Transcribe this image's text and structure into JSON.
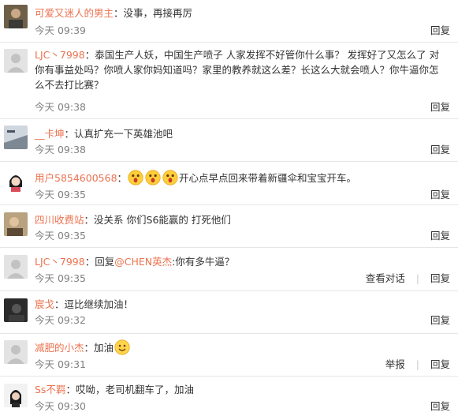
{
  "actions": {
    "reply": "回复",
    "view_conversation": "查看对话",
    "report": "举报",
    "separator": "|"
  },
  "comments": [
    {
      "username": "可爱又迷人的男主",
      "colon": "：",
      "text": "没事，再接再厉",
      "time": "今天 09:39",
      "avatar_icon": "avatar-photo-icon"
    },
    {
      "username": "LJC丶7998",
      "colon": "：",
      "text": "泰国生产人妖，中国生产喷子 人家发挥不好管你什么事？ 发挥好了又怎么了 对你有事益处吗？你喷人家你妈知道吗？家里的教养就这么差？长这么大就会喷人？你牛逼你怎么不去打比赛？",
      "time": "今天 09:38",
      "avatar_icon": "default-avatar-icon"
    },
    {
      "username": "__卡坤",
      "colon": "：",
      "text": "认真扩充一下英雄池吧",
      "time": "今天 09:38",
      "avatar_icon": "avatar-photo-icon"
    },
    {
      "username": "用户5854600568",
      "colon": "：",
      "text": "开心点早点回来带着新疆伞和宝宝开车。",
      "time": "今天 09:35",
      "avatar_icon": "avatar-photo-icon"
    },
    {
      "username": "四川收费站",
      "colon": "：",
      "text": "没关系 你们S6能赢的 打死他们",
      "time": "今天 09:35",
      "avatar_icon": "avatar-photo-icon"
    },
    {
      "username": "LJC丶7998",
      "colon": "：",
      "text_prefix": "回复",
      "mention": "@CHEN英杰",
      "text": ":你有多牛逼？",
      "time": "今天 09:35",
      "avatar_icon": "default-avatar-icon"
    },
    {
      "username": "宸戈",
      "colon": "：",
      "text": "逗比继续加油！",
      "time": "今天 09:32",
      "avatar_icon": "avatar-photo-icon"
    },
    {
      "username": "减肥的小杰",
      "colon": "：",
      "text": "加油",
      "time": "今天 09:31",
      "avatar_icon": "default-avatar-icon"
    },
    {
      "username": "Ss不羁",
      "colon": "：",
      "text": "哎呦，老司机翻车了，加油",
      "time": "今天 09:30",
      "avatar_icon": "avatar-photo-icon"
    }
  ]
}
